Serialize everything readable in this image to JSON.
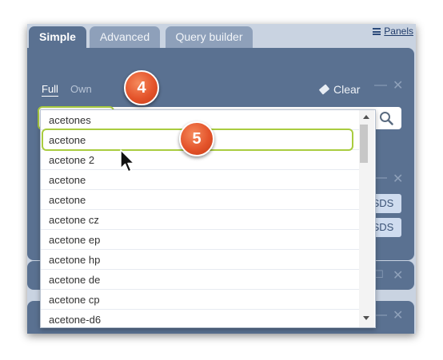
{
  "tabs": [
    {
      "label": "Simple"
    },
    {
      "label": "Advanced"
    },
    {
      "label": "Query builder"
    }
  ],
  "panels_link": "Panels",
  "search_mode": {
    "full": "Full",
    "own": "Own"
  },
  "clear_label": "Clear",
  "search": {
    "value": "acetone"
  },
  "badges": {
    "step_search": "4",
    "step_select": "5"
  },
  "side_buttons": [
    "SDS",
    "SDS"
  ],
  "suggestions": [
    "acetones",
    "acetone",
    "acetone 2",
    "acetone",
    "acetone",
    "acetone cz",
    "acetone ep",
    "acetone hp",
    "acetone de",
    "acetone cp",
    "acetone-d6"
  ],
  "highlighted_suggestion_index": 1,
  "colors": {
    "panel": "#5a7191",
    "highlight": "#a9cc3f",
    "badge": "#e4542b"
  }
}
